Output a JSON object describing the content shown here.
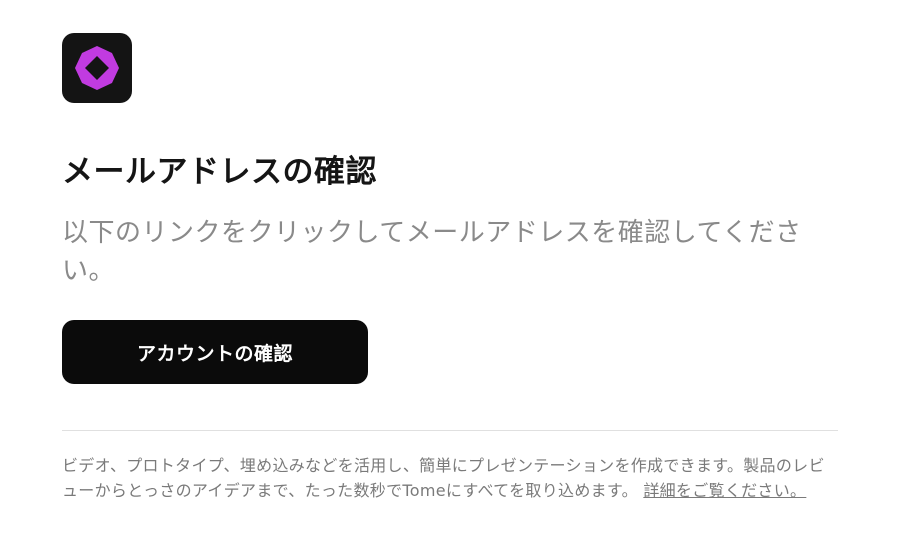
{
  "brand": {
    "logo_icon": "tome-diamond-logo-icon",
    "accent": "#c13be0"
  },
  "heading": "メールアドレスの確認",
  "description": "以下のリンクをクリックしてメールアドレスを確認してください。",
  "cta": {
    "label": "アカウントの確認"
  },
  "footer": {
    "text": "ビデオ、プロトタイプ、埋め込みなどを活用し、簡単にプレゼンテーションを作成できます。製品のレビューからとっさのアイデアまで、たった数秒でTomeにすべてを取り込めます。",
    "link_label": "詳細をご覧ください。"
  }
}
